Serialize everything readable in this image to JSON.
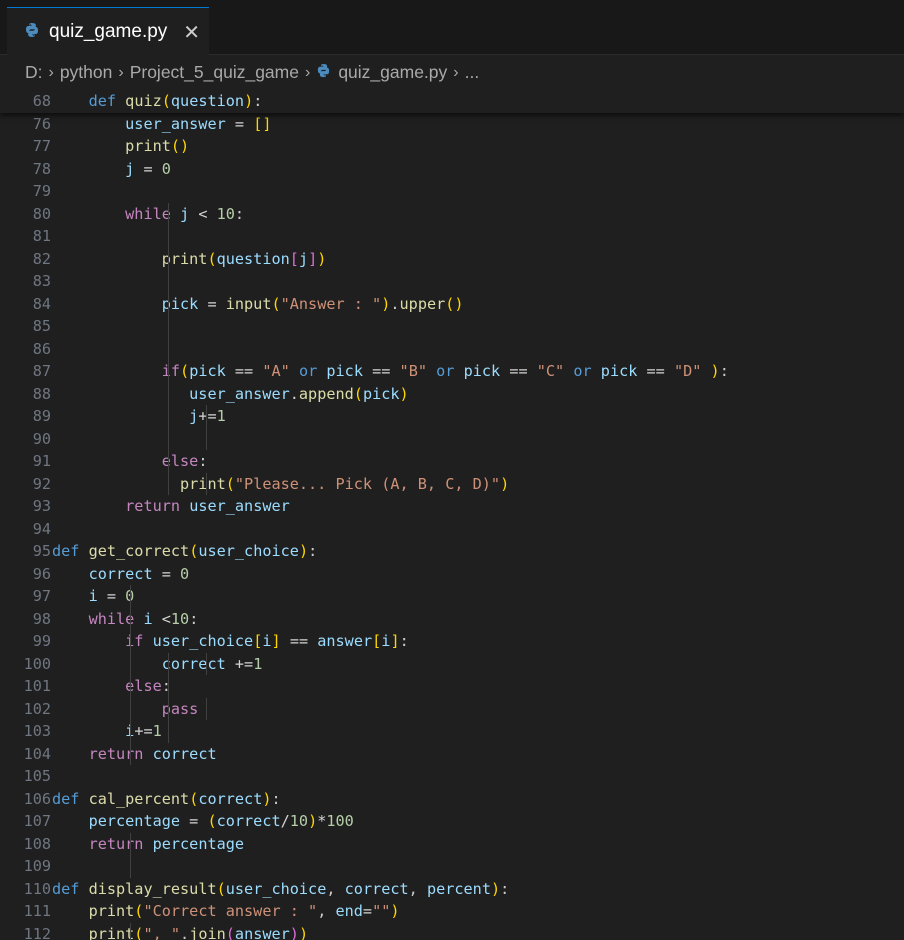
{
  "editor": {
    "tab": {
      "label": "quiz_game.py",
      "close_glyph": "✕",
      "icon": "python-icon"
    },
    "breadcrumb": {
      "items": [
        "D:",
        "python",
        "Project_5_quiz_game",
        "quiz_game.py",
        "..."
      ],
      "separator_glyph": "›"
    },
    "colors": {
      "background": "#1f1f1f",
      "keyword": "#569cd6",
      "control": "#c586c0",
      "function": "#dcdcaa",
      "variable": "#9cdcfe",
      "number": "#b5cea8",
      "string": "#ce9178",
      "bracket1": "#ffd700",
      "bracket2": "#da70d6",
      "active_tab_border": "#0078d4"
    },
    "lines": [
      {
        "n": "68",
        "sticky": true,
        "t": [
          [
            "    ",
            ""
          ],
          [
            "def",
            "k"
          ],
          [
            " ",
            ""
          ],
          [
            "quiz",
            "f"
          ],
          [
            "(",
            "p1"
          ],
          [
            "question",
            "v"
          ],
          [
            ")",
            "p1"
          ],
          [
            ":",
            ""
          ]
        ]
      },
      {
        "n": "76",
        "t": [
          [
            "        ",
            ""
          ],
          [
            "user_answer",
            "v"
          ],
          [
            " = ",
            "o"
          ],
          [
            "[]",
            "p1"
          ]
        ]
      },
      {
        "n": "77",
        "t": [
          [
            "        ",
            ""
          ],
          [
            "print",
            "f"
          ],
          [
            "()",
            "p1"
          ]
        ]
      },
      {
        "n": "78",
        "t": [
          [
            "        ",
            ""
          ],
          [
            "j",
            "v"
          ],
          [
            " = ",
            "o"
          ],
          [
            "0",
            "n"
          ]
        ]
      },
      {
        "n": "79",
        "t": []
      },
      {
        "n": "80",
        "t": [
          [
            "        ",
            ""
          ],
          [
            "while",
            "c"
          ],
          [
            " ",
            ""
          ],
          [
            "j",
            "v"
          ],
          [
            " < ",
            "o"
          ],
          [
            "10",
            "n"
          ],
          [
            ":",
            ""
          ]
        ]
      },
      {
        "n": "81",
        "t": []
      },
      {
        "n": "82",
        "t": [
          [
            "            ",
            ""
          ],
          [
            "print",
            "f"
          ],
          [
            "(",
            "p1"
          ],
          [
            "question",
            "v"
          ],
          [
            "[",
            "p2"
          ],
          [
            "j",
            "v"
          ],
          [
            "]",
            "p2"
          ],
          [
            ")",
            "p1"
          ]
        ]
      },
      {
        "n": "83",
        "t": []
      },
      {
        "n": "84",
        "t": [
          [
            "            ",
            ""
          ],
          [
            "pick",
            "v"
          ],
          [
            " = ",
            "o"
          ],
          [
            "input",
            "f"
          ],
          [
            "(",
            "p1"
          ],
          [
            "\"Answer : \"",
            "s"
          ],
          [
            ")",
            "p1"
          ],
          [
            ".",
            ""
          ],
          [
            "upper",
            "f"
          ],
          [
            "()",
            "p1"
          ]
        ]
      },
      {
        "n": "85",
        "t": []
      },
      {
        "n": "86",
        "t": []
      },
      {
        "n": "87",
        "t": [
          [
            "            ",
            ""
          ],
          [
            "if",
            "c"
          ],
          [
            "(",
            "p1"
          ],
          [
            "pick",
            "v"
          ],
          [
            " == ",
            "o"
          ],
          [
            "\"A\"",
            "s"
          ],
          [
            " ",
            ""
          ],
          [
            "or",
            "k"
          ],
          [
            " ",
            ""
          ],
          [
            "pick",
            "v"
          ],
          [
            " == ",
            "o"
          ],
          [
            "\"B\"",
            "s"
          ],
          [
            " ",
            ""
          ],
          [
            "or",
            "k"
          ],
          [
            " ",
            ""
          ],
          [
            "pick",
            "v"
          ],
          [
            " == ",
            "o"
          ],
          [
            "\"C\"",
            "s"
          ],
          [
            " ",
            ""
          ],
          [
            "or",
            "k"
          ],
          [
            " ",
            ""
          ],
          [
            "pick",
            "v"
          ],
          [
            " == ",
            "o"
          ],
          [
            "\"D\"",
            "s"
          ],
          [
            " ",
            ""
          ],
          [
            ")",
            "p1"
          ],
          [
            ":",
            ""
          ]
        ]
      },
      {
        "n": "88",
        "t": [
          [
            "               ",
            ""
          ],
          [
            "user_answer",
            "v"
          ],
          [
            ".",
            ""
          ],
          [
            "append",
            "f"
          ],
          [
            "(",
            "p1"
          ],
          [
            "pick",
            "v"
          ],
          [
            ")",
            "p1"
          ]
        ]
      },
      {
        "n": "89",
        "t": [
          [
            "               ",
            ""
          ],
          [
            "j",
            "v"
          ],
          [
            "+=",
            "o"
          ],
          [
            "1",
            "n"
          ]
        ]
      },
      {
        "n": "90",
        "t": []
      },
      {
        "n": "91",
        "t": [
          [
            "            ",
            ""
          ],
          [
            "else",
            "c"
          ],
          [
            ":",
            ""
          ]
        ]
      },
      {
        "n": "92",
        "t": [
          [
            "              ",
            ""
          ],
          [
            "print",
            "f"
          ],
          [
            "(",
            "p1"
          ],
          [
            "\"Please... Pick (A, B, C, D)\"",
            "s"
          ],
          [
            ")",
            "p1"
          ]
        ]
      },
      {
        "n": "93",
        "t": [
          [
            "        ",
            ""
          ],
          [
            "return",
            "c"
          ],
          [
            " ",
            ""
          ],
          [
            "user_answer",
            "v"
          ]
        ]
      },
      {
        "n": "94",
        "t": []
      },
      {
        "n": "95",
        "t": [
          [
            "",
            ""
          ],
          [
            "def",
            "k"
          ],
          [
            " ",
            ""
          ],
          [
            "get_correct",
            "f"
          ],
          [
            "(",
            "p1"
          ],
          [
            "user_choice",
            "v"
          ],
          [
            ")",
            "p1"
          ],
          [
            ":",
            ""
          ]
        ]
      },
      {
        "n": "96",
        "t": [
          [
            "    ",
            ""
          ],
          [
            "correct",
            "v"
          ],
          [
            " = ",
            "o"
          ],
          [
            "0",
            "n"
          ]
        ]
      },
      {
        "n": "97",
        "t": [
          [
            "    ",
            ""
          ],
          [
            "i",
            "v"
          ],
          [
            " = ",
            "o"
          ],
          [
            "0",
            "n"
          ]
        ]
      },
      {
        "n": "98",
        "t": [
          [
            "    ",
            ""
          ],
          [
            "while",
            "c"
          ],
          [
            " ",
            ""
          ],
          [
            "i",
            "v"
          ],
          [
            " <",
            "o"
          ],
          [
            "10",
            "n"
          ],
          [
            ":",
            ""
          ]
        ]
      },
      {
        "n": "99",
        "t": [
          [
            "        ",
            ""
          ],
          [
            "if",
            "c"
          ],
          [
            " ",
            ""
          ],
          [
            "user_choice",
            "v"
          ],
          [
            "[",
            "p1"
          ],
          [
            "i",
            "v"
          ],
          [
            "]",
            "p1"
          ],
          [
            " == ",
            "o"
          ],
          [
            "answer",
            "v"
          ],
          [
            "[",
            "p1"
          ],
          [
            "i",
            "v"
          ],
          [
            "]",
            "p1"
          ],
          [
            ":",
            ""
          ]
        ]
      },
      {
        "n": "100",
        "t": [
          [
            "            ",
            ""
          ],
          [
            "correct",
            "v"
          ],
          [
            " +=",
            "o"
          ],
          [
            "1",
            "n"
          ]
        ]
      },
      {
        "n": "101",
        "t": [
          [
            "        ",
            ""
          ],
          [
            "else",
            "c"
          ],
          [
            ":",
            ""
          ]
        ]
      },
      {
        "n": "102",
        "t": [
          [
            "            ",
            ""
          ],
          [
            "pass",
            "c"
          ]
        ]
      },
      {
        "n": "103",
        "t": [
          [
            "        ",
            ""
          ],
          [
            "i",
            "v"
          ],
          [
            "+=",
            "o"
          ],
          [
            "1",
            "n"
          ]
        ]
      },
      {
        "n": "104",
        "t": [
          [
            "    ",
            ""
          ],
          [
            "return",
            "c"
          ],
          [
            " ",
            ""
          ],
          [
            "correct",
            "v"
          ]
        ]
      },
      {
        "n": "105",
        "t": []
      },
      {
        "n": "106",
        "t": [
          [
            "",
            ""
          ],
          [
            "def",
            "k"
          ],
          [
            " ",
            ""
          ],
          [
            "cal_percent",
            "f"
          ],
          [
            "(",
            "p1"
          ],
          [
            "correct",
            "v"
          ],
          [
            ")",
            "p1"
          ],
          [
            ":",
            ""
          ]
        ]
      },
      {
        "n": "107",
        "t": [
          [
            "    ",
            ""
          ],
          [
            "percentage",
            "v"
          ],
          [
            " = ",
            "o"
          ],
          [
            "(",
            "p1"
          ],
          [
            "correct",
            "v"
          ],
          [
            "/",
            "o"
          ],
          [
            "10",
            "n"
          ],
          [
            ")",
            "p1"
          ],
          [
            "*",
            "o"
          ],
          [
            "100",
            "n"
          ]
        ]
      },
      {
        "n": "108",
        "t": [
          [
            "    ",
            ""
          ],
          [
            "return",
            "c"
          ],
          [
            " ",
            ""
          ],
          [
            "percentage",
            "v"
          ]
        ]
      },
      {
        "n": "109",
        "t": []
      },
      {
        "n": "110",
        "t": [
          [
            "",
            ""
          ],
          [
            "def",
            "k"
          ],
          [
            " ",
            ""
          ],
          [
            "display_result",
            "f"
          ],
          [
            "(",
            "p1"
          ],
          [
            "user_choice",
            "v"
          ],
          [
            ", ",
            ""
          ],
          [
            "correct",
            "v"
          ],
          [
            ", ",
            ""
          ],
          [
            "percent",
            "v"
          ],
          [
            ")",
            "p1"
          ],
          [
            ":",
            ""
          ]
        ]
      },
      {
        "n": "111",
        "t": [
          [
            "    ",
            ""
          ],
          [
            "print",
            "f"
          ],
          [
            "(",
            "p1"
          ],
          [
            "\"Correct answer : \"",
            "s"
          ],
          [
            ", ",
            ""
          ],
          [
            "end",
            "v"
          ],
          [
            "=",
            "o"
          ],
          [
            "\"\"",
            "s"
          ],
          [
            ")",
            "p1"
          ]
        ]
      },
      {
        "n": "112",
        "t": [
          [
            "    ",
            ""
          ],
          [
            "print",
            "f"
          ],
          [
            "(",
            "p1"
          ],
          [
            "\", \"",
            "s"
          ],
          [
            ".",
            ""
          ],
          [
            "join",
            "f"
          ],
          [
            "(",
            "p2"
          ],
          [
            "answer",
            "v"
          ],
          [
            ")",
            "p2"
          ],
          [
            ")",
            "p1"
          ]
        ]
      }
    ]
  }
}
